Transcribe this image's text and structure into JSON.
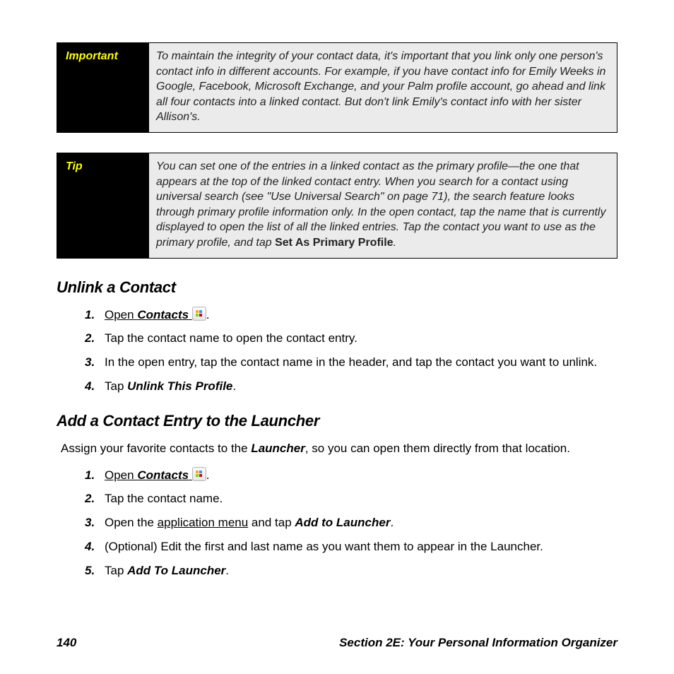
{
  "callouts": {
    "important": {
      "label": "Important",
      "text": "To maintain the integrity of your contact data, it's important that you link only one person's contact info in different accounts. For example, if you have contact info for Emily Weeks in Google, Facebook, Microsoft Exchange, and your Palm profile account, go ahead and link all four contacts into a linked contact. But don't link Emily's contact info with her sister Allison's."
    },
    "tip": {
      "label": "Tip",
      "text_before_bold": "You can set one of the entries in a linked contact as the primary profile—the one that appears at the top of the linked contact entry. When you search for a contact using universal search (see \"Use Universal Search\" on page 71), the search feature looks through primary profile information only. In the open contact, tap the name that is currently displayed to open the list of all the linked entries. Tap the contact you want to use as the primary profile, and tap ",
      "bold": "Set As Primary Profile",
      "text_after_bold": "."
    }
  },
  "sections": {
    "unlink": {
      "heading": "Unlink a Contact",
      "steps": {
        "s1_open": "Open",
        "s1_app": "Contacts",
        "s2": "Tap the contact name to open the contact entry.",
        "s3": "In the open entry, tap the contact name in the header, and tap the contact you want to unlink.",
        "s4_pre": "Tap ",
        "s4_bold": "Unlink This Profile",
        "s4_post": "."
      }
    },
    "launcher": {
      "heading": "Add a Contact Entry to the Launcher",
      "intro_pre": "Assign your favorite contacts to the ",
      "intro_bold": "Launcher",
      "intro_post": ", so you can open them directly from that location.",
      "steps": {
        "s1_open": "Open",
        "s1_app": "Contacts",
        "s2": "Tap the contact name.",
        "s3_pre": "Open the ",
        "s3_u": "application menu",
        "s3_mid": " and tap ",
        "s3_bold": "Add to Launcher",
        "s3_post": ".",
        "s4": "(Optional) Edit the first and last name as you want them to appear in the Launcher.",
        "s5_pre": "Tap ",
        "s5_bold": "Add To Launcher",
        "s5_post": "."
      }
    }
  },
  "footer": {
    "page": "140",
    "section": "Section 2E: Your Personal Information Organizer"
  }
}
